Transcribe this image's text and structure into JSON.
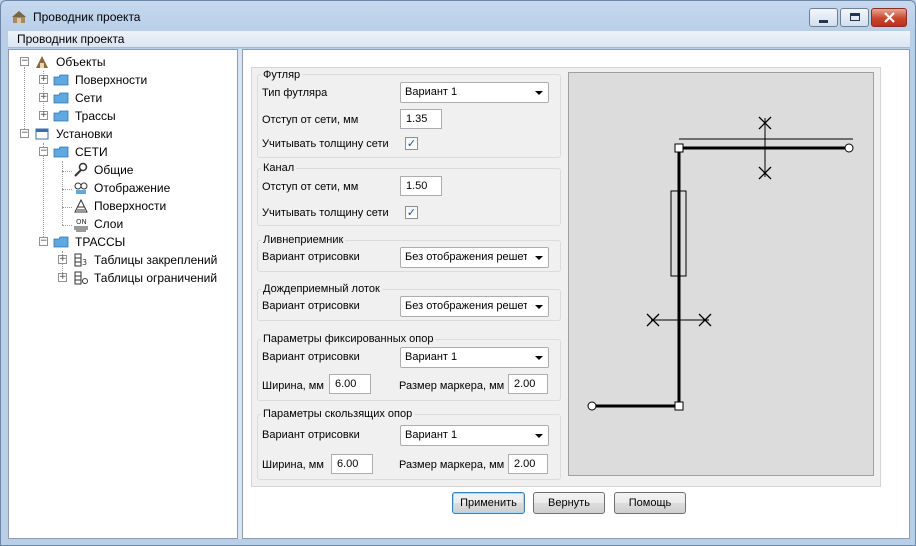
{
  "window": {
    "title": "Проводник проекта"
  },
  "menu": {
    "items": [
      "Проводник проекта"
    ]
  },
  "tree": {
    "objects": "Объекты",
    "surfaces": "Поверхности",
    "networks": "Сети",
    "routes": "Трассы",
    "settings": "Установки",
    "settings_networks": "СЕТИ",
    "general": "Общие",
    "display": "Отображение",
    "settings_surfaces": "Поверхности",
    "layers": "Слои",
    "settings_routes": "ТРАССЫ",
    "fix_tables": "Таблицы закреплений",
    "limit_tables": "Таблицы ограничений"
  },
  "casing": {
    "title": "Футляр",
    "type_label": "Тип футляра",
    "type_value": "Вариант 1",
    "offset_label": "Отступ от сети, мм",
    "offset_value": "1.35",
    "thickness_label": "Учитывать толщину сети"
  },
  "channel": {
    "title": "Канал",
    "offset_label": "Отступ от сети, мм",
    "offset_value": "1.50",
    "thickness_label": "Учитывать толщину сети"
  },
  "storm_inlet": {
    "title": "Ливнеприемник",
    "variant_label": "Вариант отрисовки",
    "variant_value": "Без отображения решетки"
  },
  "rain_tray": {
    "title": "Дождеприемный лоток",
    "variant_label": "Вариант отрисовки",
    "variant_value": "Без отображения решетки"
  },
  "fixed_supports": {
    "title": "Параметры фиксированных опор",
    "variant_label": "Вариант отрисовки",
    "variant_value": "Вариант 1",
    "width_label": "Ширина, мм",
    "width_value": "6.00",
    "marker_label": "Размер маркера, мм",
    "marker_value": "2.00"
  },
  "sliding_supports": {
    "title": "Параметры скользящих опор",
    "variant_label": "Вариант отрисовки",
    "variant_value": "Вариант 1",
    "width_label": "Ширина, мм",
    "width_value": "6.00",
    "marker_label": "Размер маркера, мм",
    "marker_value": "2.00"
  },
  "buttons": {
    "apply": "Применить",
    "revert": "Вернуть",
    "help": "Помощь"
  }
}
